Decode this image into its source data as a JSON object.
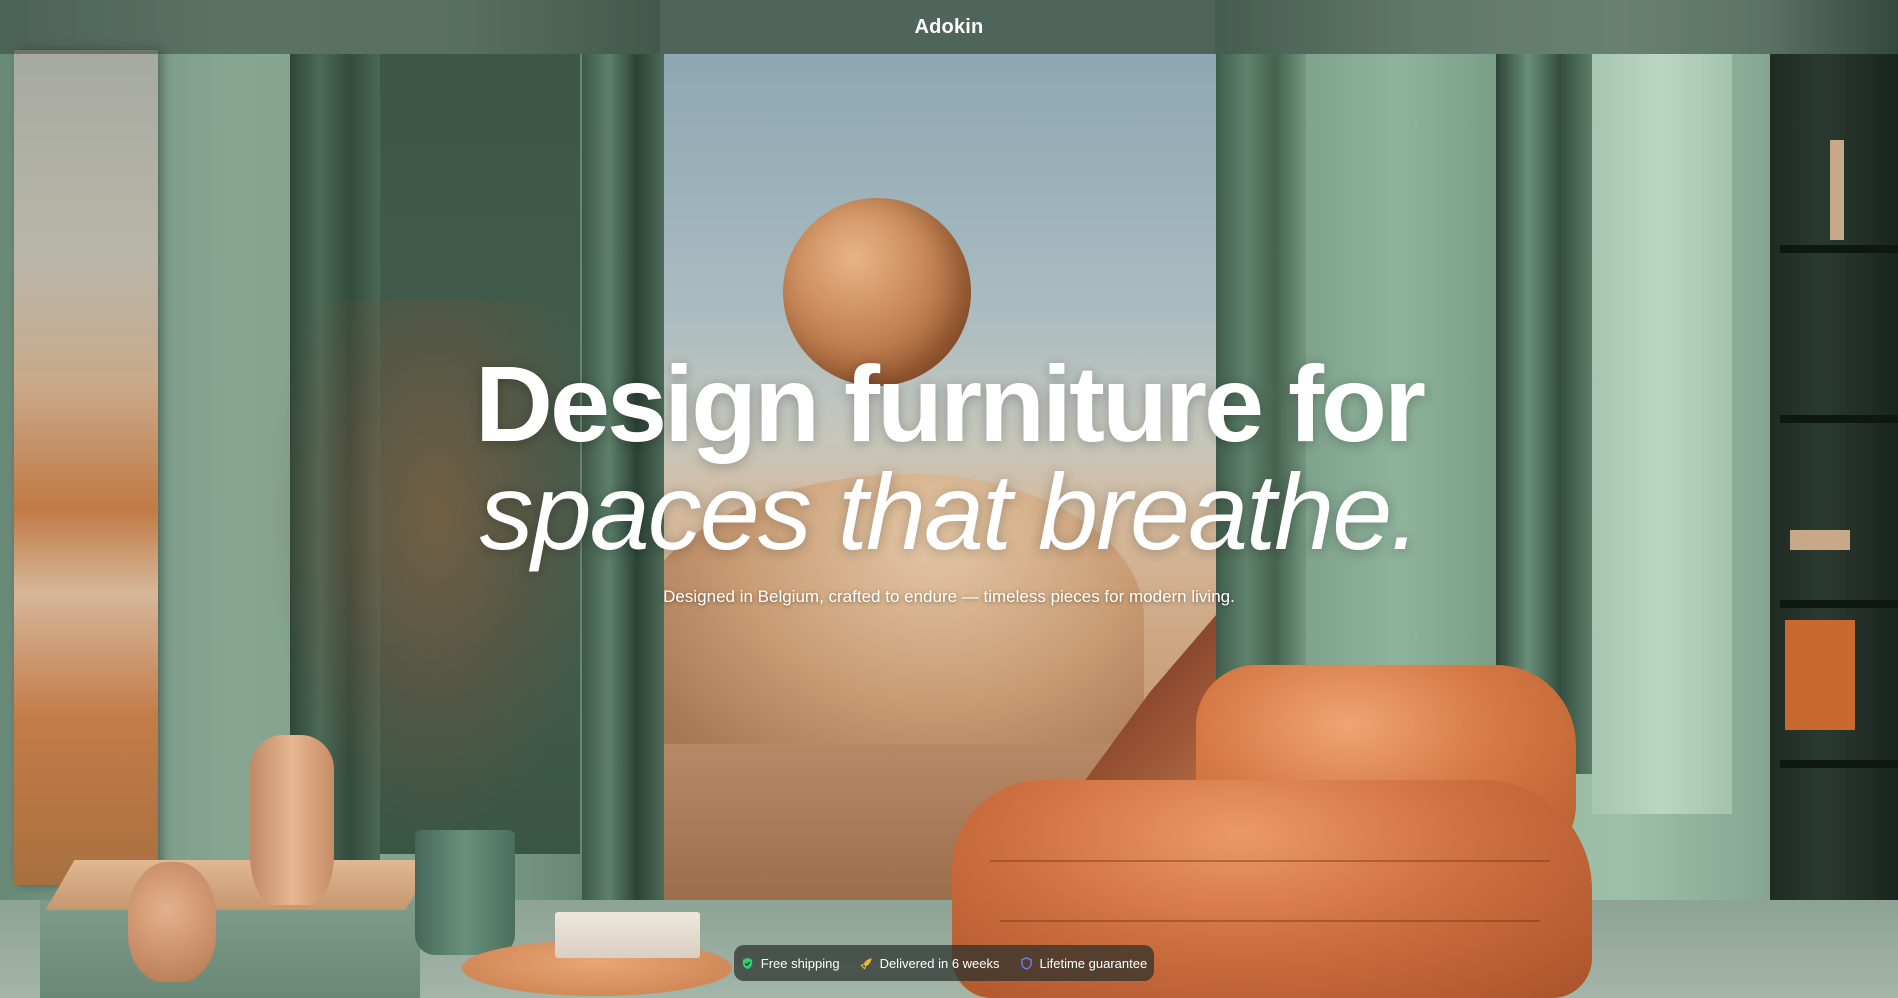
{
  "header": {
    "brand": "Adokin"
  },
  "hero": {
    "headline_line1": "Design furniture for",
    "headline_line2": "spaces that breathe.",
    "tagline": "Designed in Belgium, crafted to endure — timeless pieces for modern living."
  },
  "features": [
    {
      "label": "Free shipping",
      "icon": "shield-check-icon",
      "color": "#2bd46a"
    },
    {
      "label": "Delivered in 6 weeks",
      "icon": "rocket-icon",
      "color": "#f0b92e"
    },
    {
      "label": "Lifetime guarantee",
      "icon": "shield-icon",
      "color": "#6b7cff"
    }
  ]
}
